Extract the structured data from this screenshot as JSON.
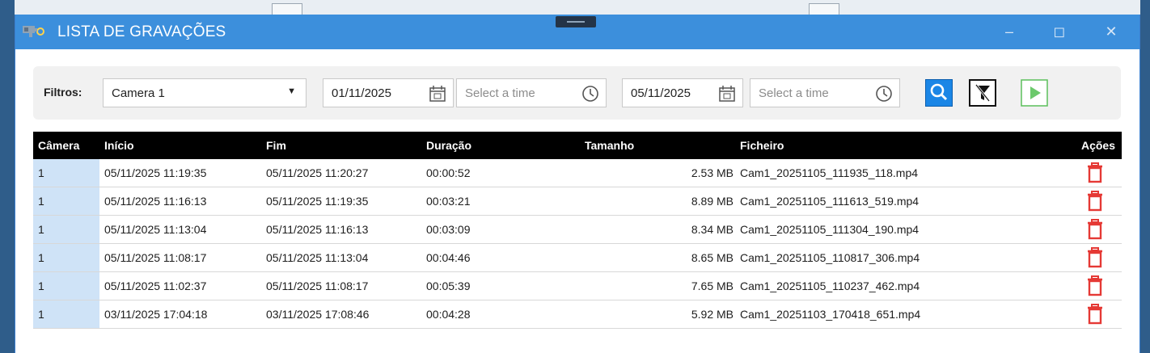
{
  "window": {
    "title": "LISTA DE GRAVAÇÕES",
    "title_color": "#3c8fdc",
    "controls": [
      "minimize-icon",
      "maximize-icon",
      "close-icon"
    ]
  },
  "filters": {
    "label": "Filtros:",
    "camera_select": {
      "value": "Camera 1"
    },
    "start_date": {
      "value": "01/11/2025"
    },
    "start_time": {
      "placeholder": "Select a time"
    },
    "end_date": {
      "value": "05/11/2025"
    },
    "end_time": {
      "placeholder": "Select a time"
    },
    "buttons": [
      "search-icon",
      "clear-filter-icon",
      "play-icon"
    ],
    "search_color": "#1b86e6",
    "play_color": "#5bbf5b"
  },
  "table": {
    "headers": {
      "camera": "Câmera",
      "start": "Início",
      "end": "Fim",
      "duration": "Duração",
      "size": "Tamanho",
      "file": "Ficheiro",
      "actions": "Ações"
    },
    "rows": [
      {
        "camera": "1",
        "start": "05/11/2025 11:19:35",
        "end": "05/11/2025 11:20:27",
        "duration": "00:00:52",
        "size": "2.53 MB",
        "file": "Cam1_20251105_111935_118.mp4"
      },
      {
        "camera": "1",
        "start": "05/11/2025 11:16:13",
        "end": "05/11/2025 11:19:35",
        "duration": "00:03:21",
        "size": "8.89 MB",
        "file": "Cam1_20251105_111613_519.mp4"
      },
      {
        "camera": "1",
        "start": "05/11/2025 11:13:04",
        "end": "05/11/2025 11:16:13",
        "duration": "00:03:09",
        "size": "8.34 MB",
        "file": "Cam1_20251105_111304_190.mp4"
      },
      {
        "camera": "1",
        "start": "05/11/2025 11:08:17",
        "end": "05/11/2025 11:13:04",
        "duration": "00:04:46",
        "size": "8.65 MB",
        "file": "Cam1_20251105_110817_306.mp4"
      },
      {
        "camera": "1",
        "start": "05/11/2025 11:02:37",
        "end": "05/11/2025 11:08:17",
        "duration": "00:05:39",
        "size": "7.65 MB",
        "file": "Cam1_20251105_110237_462.mp4"
      },
      {
        "camera": "1",
        "start": "03/11/2025 17:04:18",
        "end": "03/11/2025 17:08:46",
        "duration": "00:04:28",
        "size": "5.92 MB",
        "file": "Cam1_20251103_170418_651.mp4"
      }
    ],
    "delete_icon": "trash-icon",
    "delete_color": "#e53935"
  }
}
